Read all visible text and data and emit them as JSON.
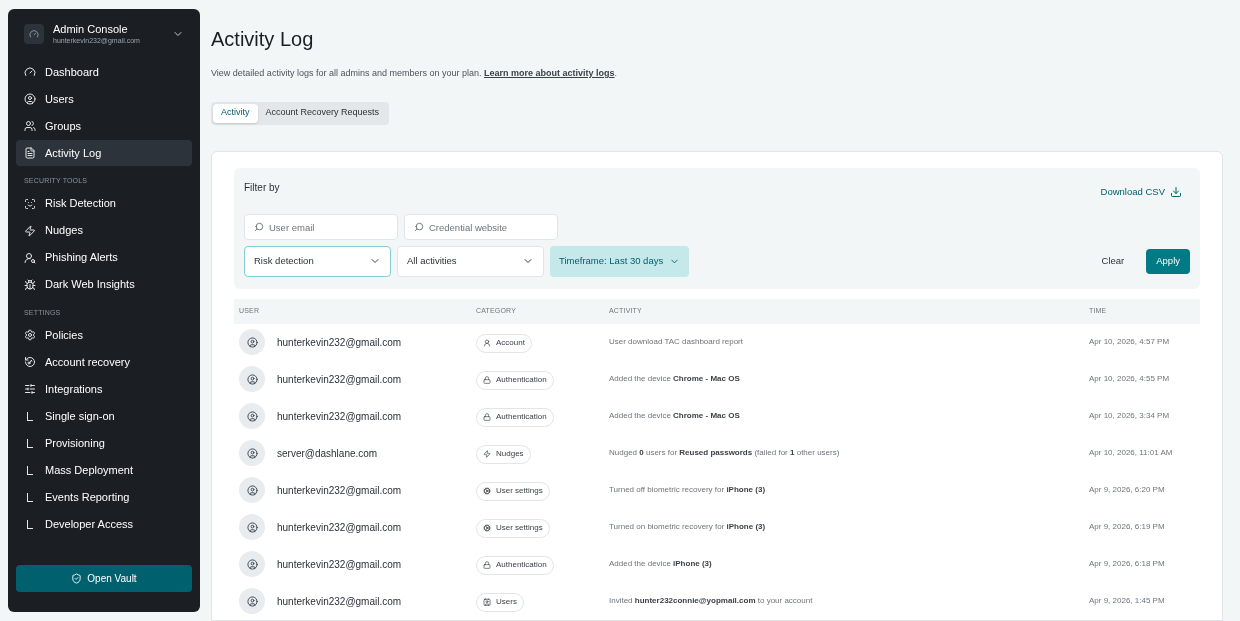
{
  "sidebar": {
    "account": {
      "title": "Admin Console",
      "email": "hunterkevin232@gmail.com"
    },
    "sections": [
      {
        "items": [
          {
            "label": "Dashboard",
            "kind": "nav",
            "selected": false
          },
          {
            "label": "Users",
            "kind": "nav",
            "selected": false
          },
          {
            "label": "Groups",
            "kind": "nav",
            "selected": false
          },
          {
            "label": "Activity Log",
            "kind": "nav",
            "selected": true
          }
        ]
      },
      {
        "heading": "SECURITY TOOLS",
        "items": [
          {
            "label": "Risk Detection",
            "kind": "nav",
            "selected": false
          },
          {
            "label": "Nudges",
            "kind": "nav",
            "selected": false
          },
          {
            "label": "Phishing Alerts",
            "kind": "nav",
            "selected": false
          },
          {
            "label": "Dark Web Insights",
            "kind": "nav",
            "selected": false
          }
        ]
      },
      {
        "heading": "SETTINGS",
        "items": [
          {
            "label": "Policies",
            "kind": "nav",
            "selected": false
          },
          {
            "label": "Account recovery",
            "kind": "nav",
            "selected": false
          },
          {
            "label": "Integrations",
            "kind": "nav",
            "selected": false
          },
          {
            "label": "Single sign-on",
            "kind": "sub",
            "selected": false
          },
          {
            "label": "Provisioning",
            "kind": "sub",
            "selected": false
          },
          {
            "label": "Mass Deployment",
            "kind": "sub",
            "selected": false
          },
          {
            "label": "Events Reporting",
            "kind": "sub",
            "selected": false
          },
          {
            "label": "Developer Access",
            "kind": "sub",
            "selected": false
          }
        ]
      }
    ],
    "button": "Open Vault"
  },
  "page": {
    "title": "Activity Log",
    "description": "View detailed activity logs for all admins and members on your plan.",
    "link": "Learn more about activity logs",
    "link_suffix": ".",
    "tabs": [
      {
        "label": "Activity",
        "selected": true
      },
      {
        "label": "Account Recovery Requests",
        "selected": false
      }
    ]
  },
  "filters": {
    "title": "Filter by",
    "download": "Download CSV",
    "search_fields": [
      {
        "placeholder": "User email"
      },
      {
        "placeholder": "Credential website"
      }
    ],
    "dropdowns": [
      {
        "value": "Risk detection",
        "focused": true
      },
      {
        "value": "All activities",
        "focused": false
      }
    ],
    "timeframe": "Timeframe: Last 30 days",
    "clear": "Clear",
    "apply": "Apply"
  },
  "table": {
    "columns": [
      "USER",
      "CATEGORY",
      "ACTIVITY",
      "TIME"
    ],
    "rows": [
      {
        "user": "hunterkevin232@gmail.com",
        "category": "Account",
        "activity": "User download TAC dashboard report",
        "time": "Apr 10, 2026, 4:57 PM"
      },
      {
        "user": "hunterkevin232@gmail.com",
        "category": "Authentication",
        "activity": "Added the device **Chrome - Mac OS**",
        "time": "Apr 10, 2026, 4:55 PM"
      },
      {
        "user": "hunterkevin232@gmail.com",
        "category": "Authentication",
        "activity": "Added the device **Chrome - Mac OS**",
        "time": "Apr 10, 2026, 3:34 PM"
      },
      {
        "user": "server@dashlane.com",
        "category": "Nudges",
        "activity": "Nudged **0** users for **Reused passwords** (failed for **1** other users)",
        "time": "Apr 10, 2026, 11:01 AM"
      },
      {
        "user": "hunterkevin232@gmail.com",
        "category": "User settings",
        "activity": "Turned off biometric recovery for **iPhone (3)**",
        "time": "Apr 9, 2026, 6:20 PM"
      },
      {
        "user": "hunterkevin232@gmail.com",
        "category": "User settings",
        "activity": "Turned on biometric recovery for **iPhone (3)**",
        "time": "Apr 9, 2026, 6:19 PM"
      },
      {
        "user": "hunterkevin232@gmail.com",
        "category": "Authentication",
        "activity": "Added the device **iPhone (3)**",
        "time": "Apr 9, 2026, 6:18 PM"
      },
      {
        "user": "hunterkevin232@gmail.com",
        "category": "Users",
        "activity": "Invited **hunter232connie@yopmail.com** to your account",
        "time": "Apr 9, 2026, 1:45 PM"
      }
    ]
  }
}
